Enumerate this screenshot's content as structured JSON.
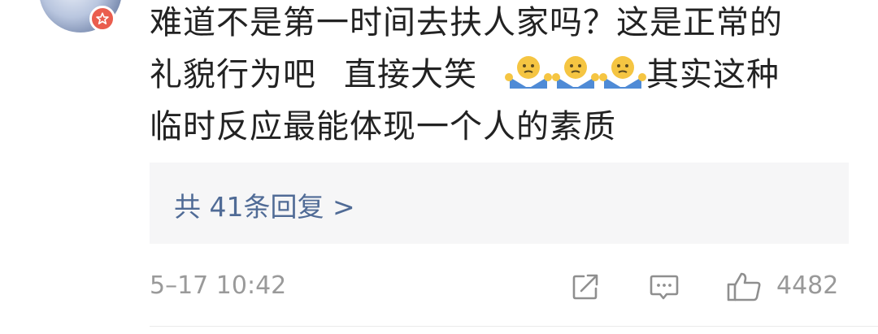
{
  "comment": {
    "line1": "难道不是第一时间去扶人家吗？这是正常的",
    "line2_a": "礼貌行为吧",
    "line2_b": "直接大笑",
    "line2_c": "其实这种",
    "line3": "临时反应最能体现一个人的素质",
    "inline_emoji": "shrug-emoji",
    "inline_emoji_count": 3
  },
  "avatar": {
    "badge_icon": "verified-star-icon",
    "badge_color": "#ea5d4e"
  },
  "replies": {
    "link_label": "共 41条回复 >",
    "color": "#506b96"
  },
  "footer": {
    "timestamp": "5–17 10:42",
    "share_icon": "share-icon",
    "comment_icon": "comment-icon",
    "like_icon": "thumbs-up-icon",
    "like_count": "4482"
  }
}
